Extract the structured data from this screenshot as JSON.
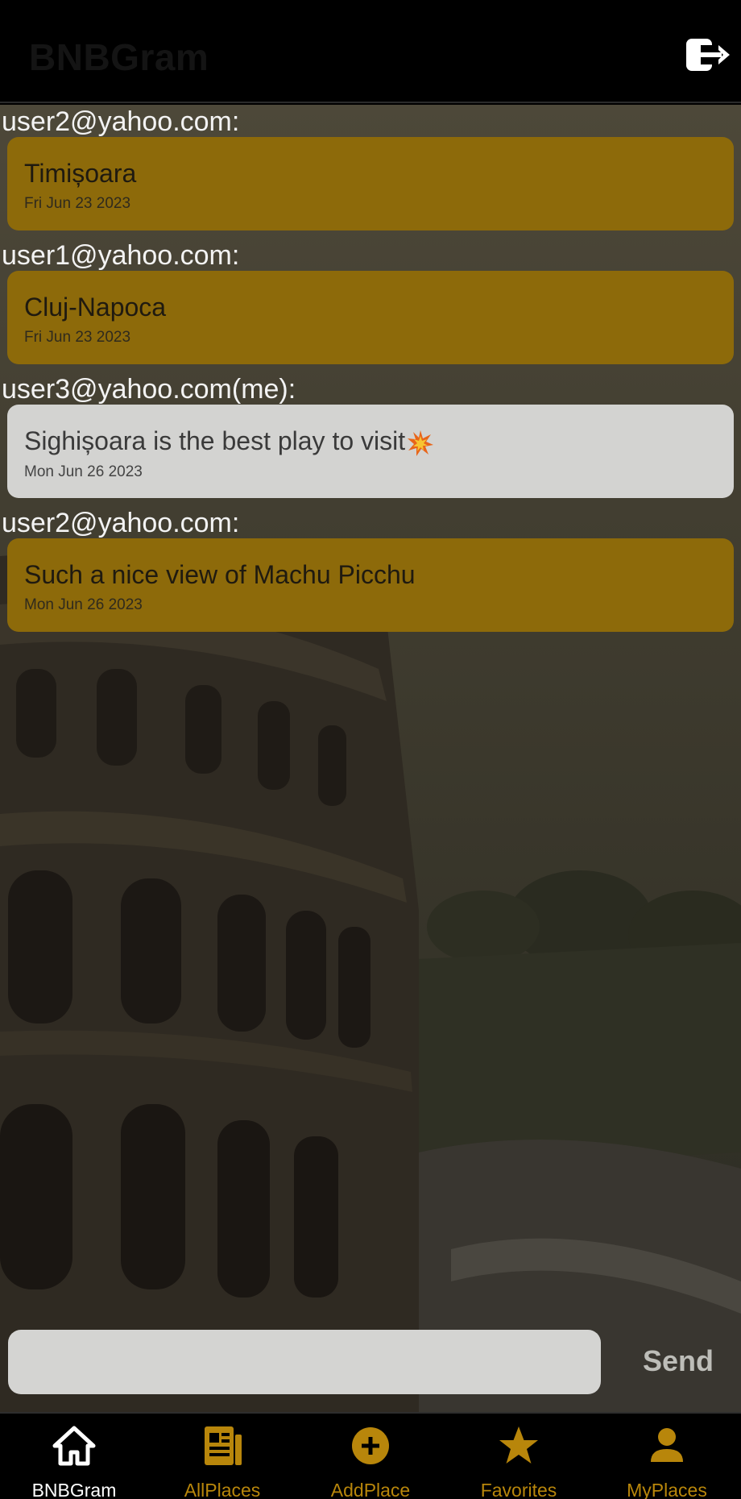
{
  "app": {
    "title": "BNBGram"
  },
  "header": {
    "logout_icon": "logout-icon"
  },
  "messages": [
    {
      "sender": "user2@yahoo.com:",
      "text": "Timișoara",
      "date": "Fri Jun 23 2023",
      "mine": false
    },
    {
      "sender": "user1@yahoo.com:",
      "text": "Cluj-Napoca",
      "date": "Fri Jun 23 2023",
      "mine": false
    },
    {
      "sender": "user3@yahoo.com(me):",
      "text": "Sighișoara is the best play to visit",
      "date": "Mon Jun 26 2023",
      "mine": true
    },
    {
      "sender": "user2@yahoo.com:",
      "text": "Such a nice view of Machu Picchu",
      "date": "Mon Jun 26 2023",
      "mine": false
    }
  ],
  "composer": {
    "value": "",
    "placeholder": "",
    "send_label": "Send"
  },
  "tabs": [
    {
      "label": "BNBGram",
      "icon": "home-icon",
      "active": true
    },
    {
      "label": "AllPlaces",
      "icon": "newspaper-icon",
      "active": false
    },
    {
      "label": "AddPlace",
      "icon": "add-circle-icon",
      "active": false
    },
    {
      "label": "Favorites",
      "icon": "star-icon",
      "active": false
    },
    {
      "label": "MyPlaces",
      "icon": "person-icon",
      "active": false
    }
  ],
  "colors": {
    "accent": "#b8860b",
    "bubble_other": "#8d6a0a",
    "bubble_me": "#d3d3d1",
    "header_bg": "#000000"
  }
}
